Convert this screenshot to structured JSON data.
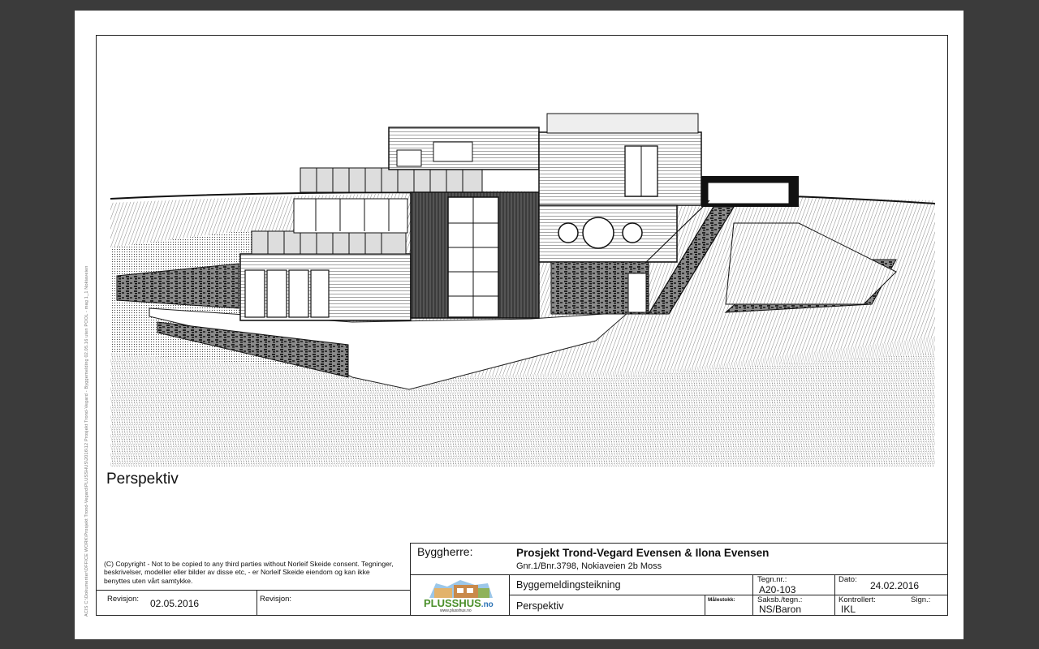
{
  "sidenote": "ACIS C:\\Dokumenter\\OFFICE WORK\\Prosjekt Trond-Vegard\\PLUSSHUS\\2016\\12 Prosjekt Trond-Vegard - Byggemelding 02.05.16 uten POOL - mag 1_1 Nokiaveien",
  "caption": "Perspektiv",
  "copyright": "(C) Copyright - Not to be copied to any third parties without Norleif Skeide consent. Tegninger, beskrivelser, modeller eller bilder av disse etc, - er Norleif Skeide eiendom og kan ikke  benyttes uten vårt samtykke.",
  "revisions": [
    {
      "label": "Revisjon:",
      "value": "02.05.2016"
    },
    {
      "label": "Revisjon:",
      "value": ""
    }
  ],
  "logo": {
    "brand": "PLUSSHUS",
    "suffix": ".no",
    "url": "www.plusshus.no"
  },
  "title_block": {
    "owner_label": "Byggherre:",
    "project": "Prosjekt Trond-Vegard Evensen & Ilona Evensen",
    "address": "Gnr.1/Bnr.3798, Nokiaveien 2b Moss",
    "drawing_type": "Byggemeldingsteikning",
    "drawing_title": "Perspektiv",
    "scale_label": "Målestokk:",
    "scale_value": "",
    "drawing_no_label": "Tegn.nr.:",
    "drawing_no": "A20-103",
    "date_label": "Dato:",
    "date": "24.02.2016",
    "drawn_by_label": "Saksb./tegn.:",
    "drawn_by": "NS/Baron",
    "checked_label": "Kontrollert:",
    "checked": "IKL",
    "sign_label": "Sign.:",
    "sign": ""
  },
  "colors": {
    "background": "#3b3b3b",
    "page": "#ffffff",
    "ink": "#111111"
  }
}
